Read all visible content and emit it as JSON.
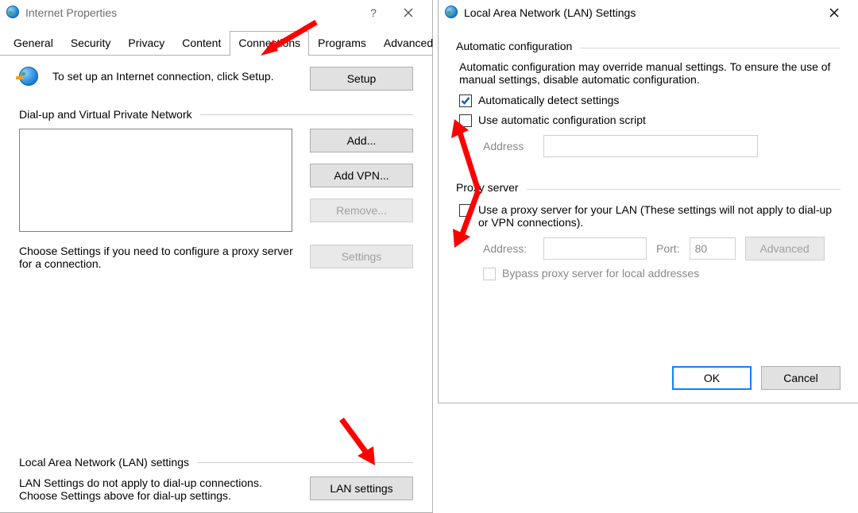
{
  "ip": {
    "title": "Internet Properties",
    "tabs": [
      "General",
      "Security",
      "Privacy",
      "Content",
      "Connections",
      "Programs",
      "Advanced"
    ],
    "active_tab": 4,
    "setup_text": "To set up an Internet connection, click Setup.",
    "setup_btn": "Setup",
    "dialup_label": "Dial-up and Virtual Private Network",
    "add_btn": "Add...",
    "addvpn_btn": "Add VPN...",
    "remove_btn": "Remove...",
    "settings_btn": "Settings",
    "choose_text": "Choose Settings if you need to configure a proxy server for a connection.",
    "lan_label": "Local Area Network (LAN) settings",
    "lan_text": "LAN Settings do not apply to dial-up connections. Choose Settings above for dial-up settings.",
    "lan_btn": "LAN settings"
  },
  "lan": {
    "title": "Local Area Network (LAN) Settings",
    "auto_legend": "Automatic configuration",
    "auto_text": "Automatic configuration may override manual settings.  To ensure the use of manual settings, disable automatic configuration.",
    "auto_detect": "Automatically detect settings",
    "auto_script": "Use automatic configuration script",
    "address_lbl": "Address",
    "proxy_legend": "Proxy server",
    "proxy_use": "Use a proxy server for your LAN (These settings will not apply to dial-up or VPN connections).",
    "address2_lbl": "Address:",
    "port_lbl": "Port:",
    "port_value": "80",
    "advanced_btn": "Advanced",
    "bypass": "Bypass proxy server for local addresses",
    "ok": "OK",
    "cancel": "Cancel"
  }
}
